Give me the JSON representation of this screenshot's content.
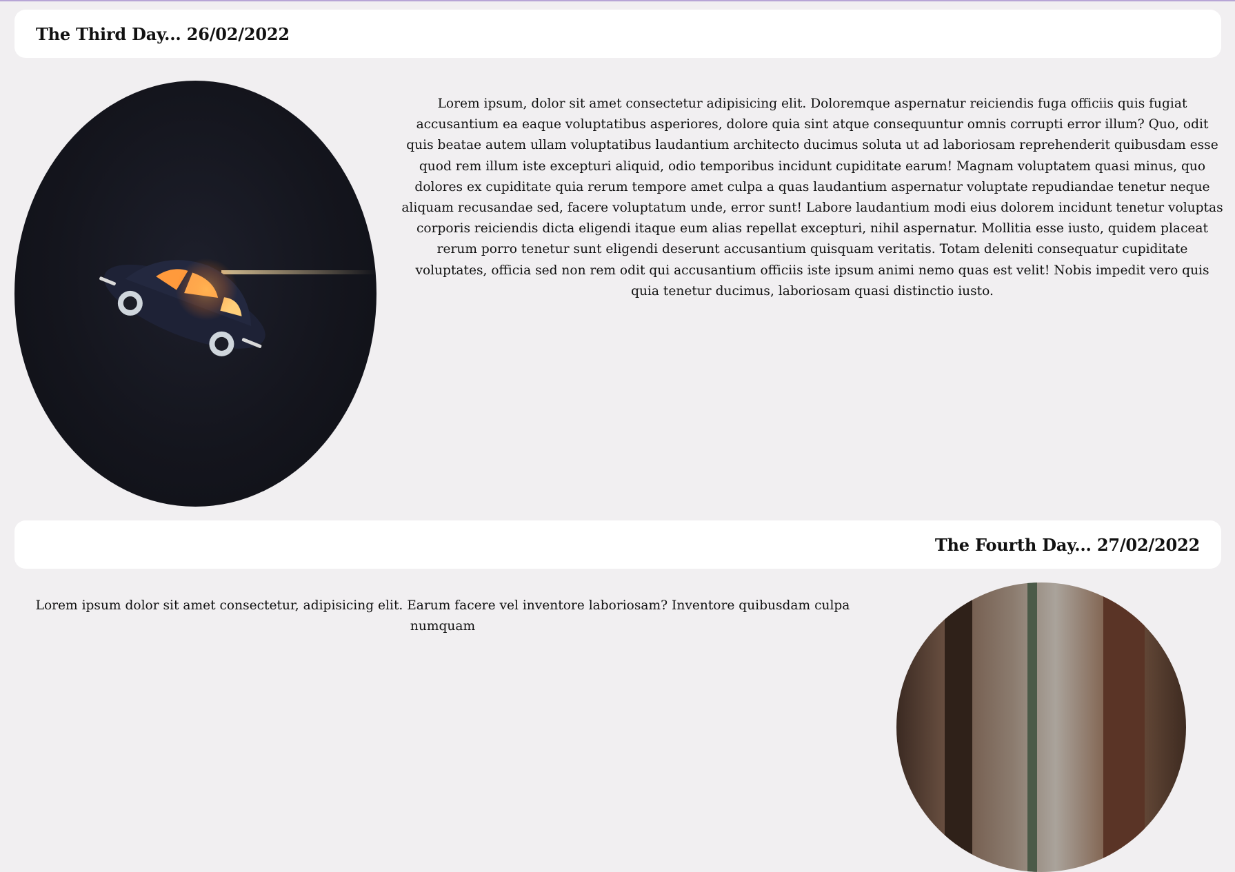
{
  "posts": [
    {
      "title": "The Third Day... 26/02/2022",
      "image_icon": "beetle-car-photo",
      "body": "Lorem ipsum, dolor sit amet consectetur adipisicing elit. Doloremque aspernatur reiciendis fuga officiis quis fugiat accusantium ea eaque voluptatibus asperiores, dolore quia sint atque consequuntur omnis corrupti error illum? Quo, odit quis beatae autem ullam voluptatibus laudantium architecto ducimus soluta ut ad laboriosam reprehenderit quibusdam esse quod rem illum iste excepturi aliquid, odio temporibus incidunt cupiditate earum! Magnam voluptatem quasi minus, quo dolores ex cupiditate quia rerum tempore amet culpa a quas laudantium aspernatur voluptate repudiandae tenetur neque aliquam recusandae sed, facere voluptatum unde, error sunt! Labore laudantium modi eius dolorem incidunt tenetur voluptas corporis reiciendis dicta eligendi itaque eum alias repellat excepturi, nihil aspernatur. Mollitia esse iusto, quidem placeat rerum porro tenetur sunt eligendi deserunt accusantium quisquam veritatis. Totam deleniti consequatur cupiditate voluptates, officia sed non rem odit qui accusantium officiis iste ipsum animi nemo quas est velit! Nobis impedit vero quis quia tenetur ducimus, laboriosam quasi distinctio iusto."
    },
    {
      "title": "The Fourth Day... 27/02/2022",
      "image_icon": "forest-trees-photo",
      "body": "Lorem ipsum dolor sit amet consectetur, adipisicing elit. Earum facere vel inventore laboriosam? Inventore quibusdam culpa numquam"
    }
  ],
  "colors": {
    "page_background": "#f1eff1",
    "card_background": "#ffffff",
    "top_accent": "#b7a5d6"
  }
}
